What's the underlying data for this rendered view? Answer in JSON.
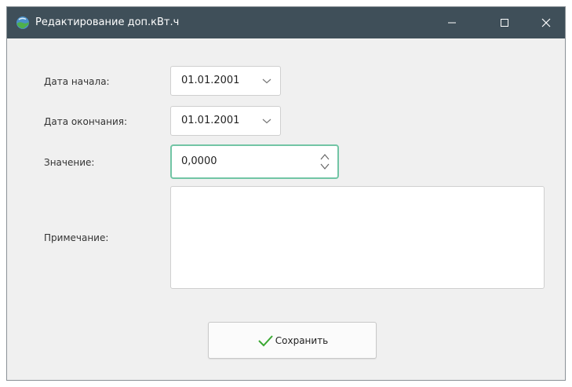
{
  "window": {
    "title": "Редактирование доп.кВт.ч",
    "icon": "globe-icon",
    "controls": {
      "minimize_icon": "minimize-icon",
      "maximize_icon": "maximize-icon",
      "close_icon": "close-icon"
    },
    "titlebar_color": "#3f4f59"
  },
  "form": {
    "start_date": {
      "label": "Дата начала:",
      "value": "01.01.2001"
    },
    "end_date": {
      "label": "Дата окончания:",
      "value": "01.01.2001"
    },
    "value": {
      "label": "Значение:",
      "value": "0,0000",
      "focus_color": "#72c5a5"
    },
    "note": {
      "label": "Примечание:",
      "value": ""
    }
  },
  "actions": {
    "save_label": "Сохранить",
    "save_icon": "checkmark-icon",
    "check_color": "#3aa832"
  }
}
